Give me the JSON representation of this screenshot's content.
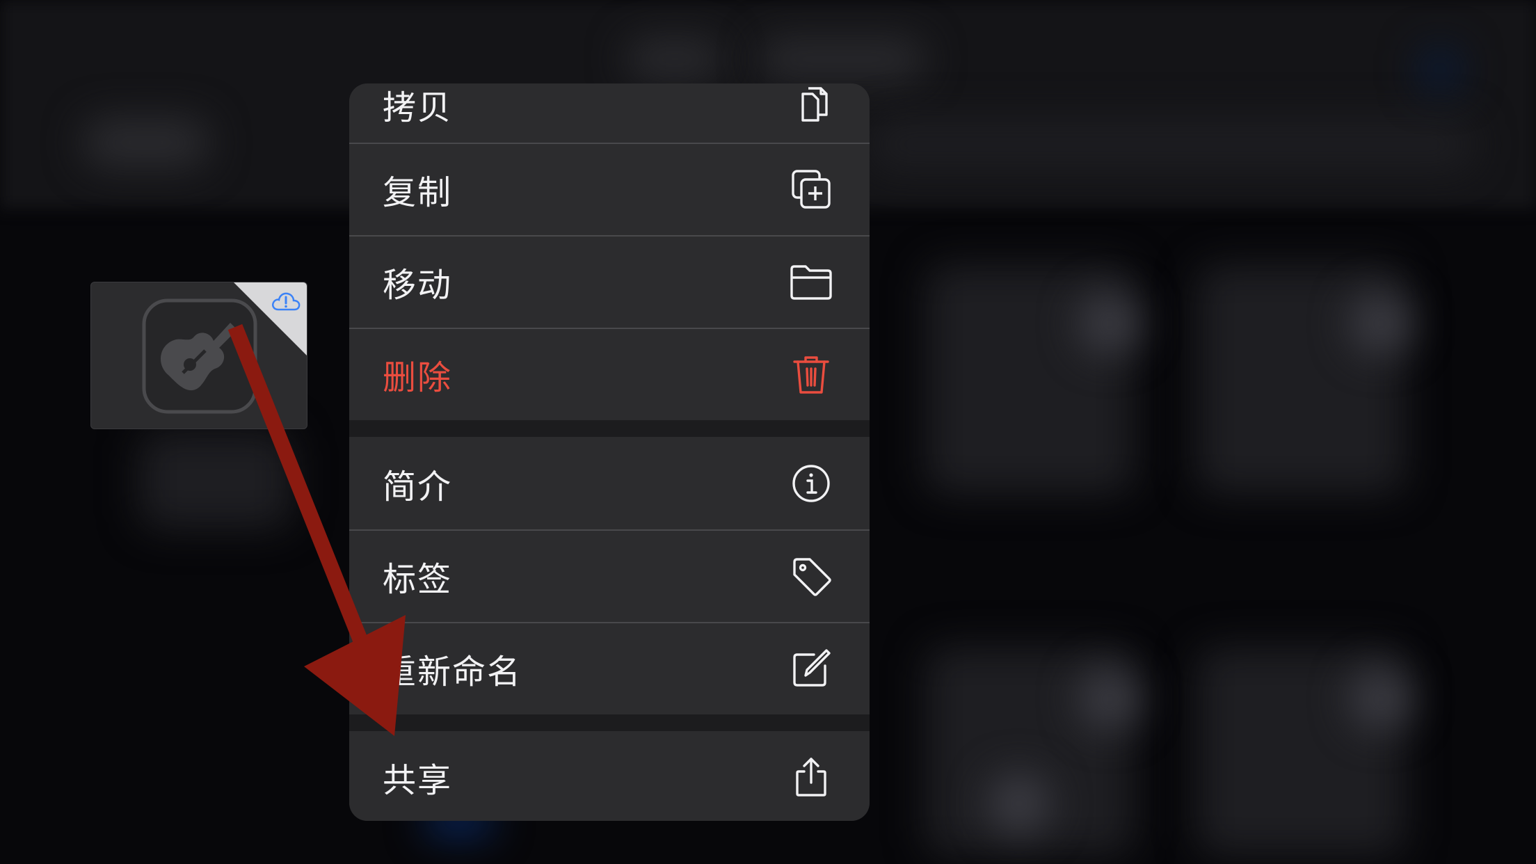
{
  "context_menu": {
    "items": [
      {
        "label": "拷贝",
        "icon": "copy-document-icon"
      },
      {
        "label": "复制",
        "icon": "duplicate-plus-icon"
      },
      {
        "label": "移动",
        "icon": "folder-icon"
      },
      {
        "label": "删除",
        "icon": "trash-icon",
        "destructive": true
      },
      {
        "label": "简介",
        "icon": "info-circle-icon"
      },
      {
        "label": "标签",
        "icon": "tag-icon"
      },
      {
        "label": "重新命名",
        "icon": "pencil-square-icon"
      },
      {
        "label": "共享",
        "icon": "share-icon"
      }
    ]
  },
  "dragged_item": {
    "icon": "garageband-guitar-icon",
    "status_icon": "icloud-alert-icon"
  },
  "annotation": {
    "type": "arrow",
    "color": "#8b1a10"
  },
  "colors": {
    "menu_background": "#2c2c2e",
    "text": "#f2f2f4",
    "destructive": "#ea4d3f",
    "cloud_badge": "#3b82f6"
  }
}
